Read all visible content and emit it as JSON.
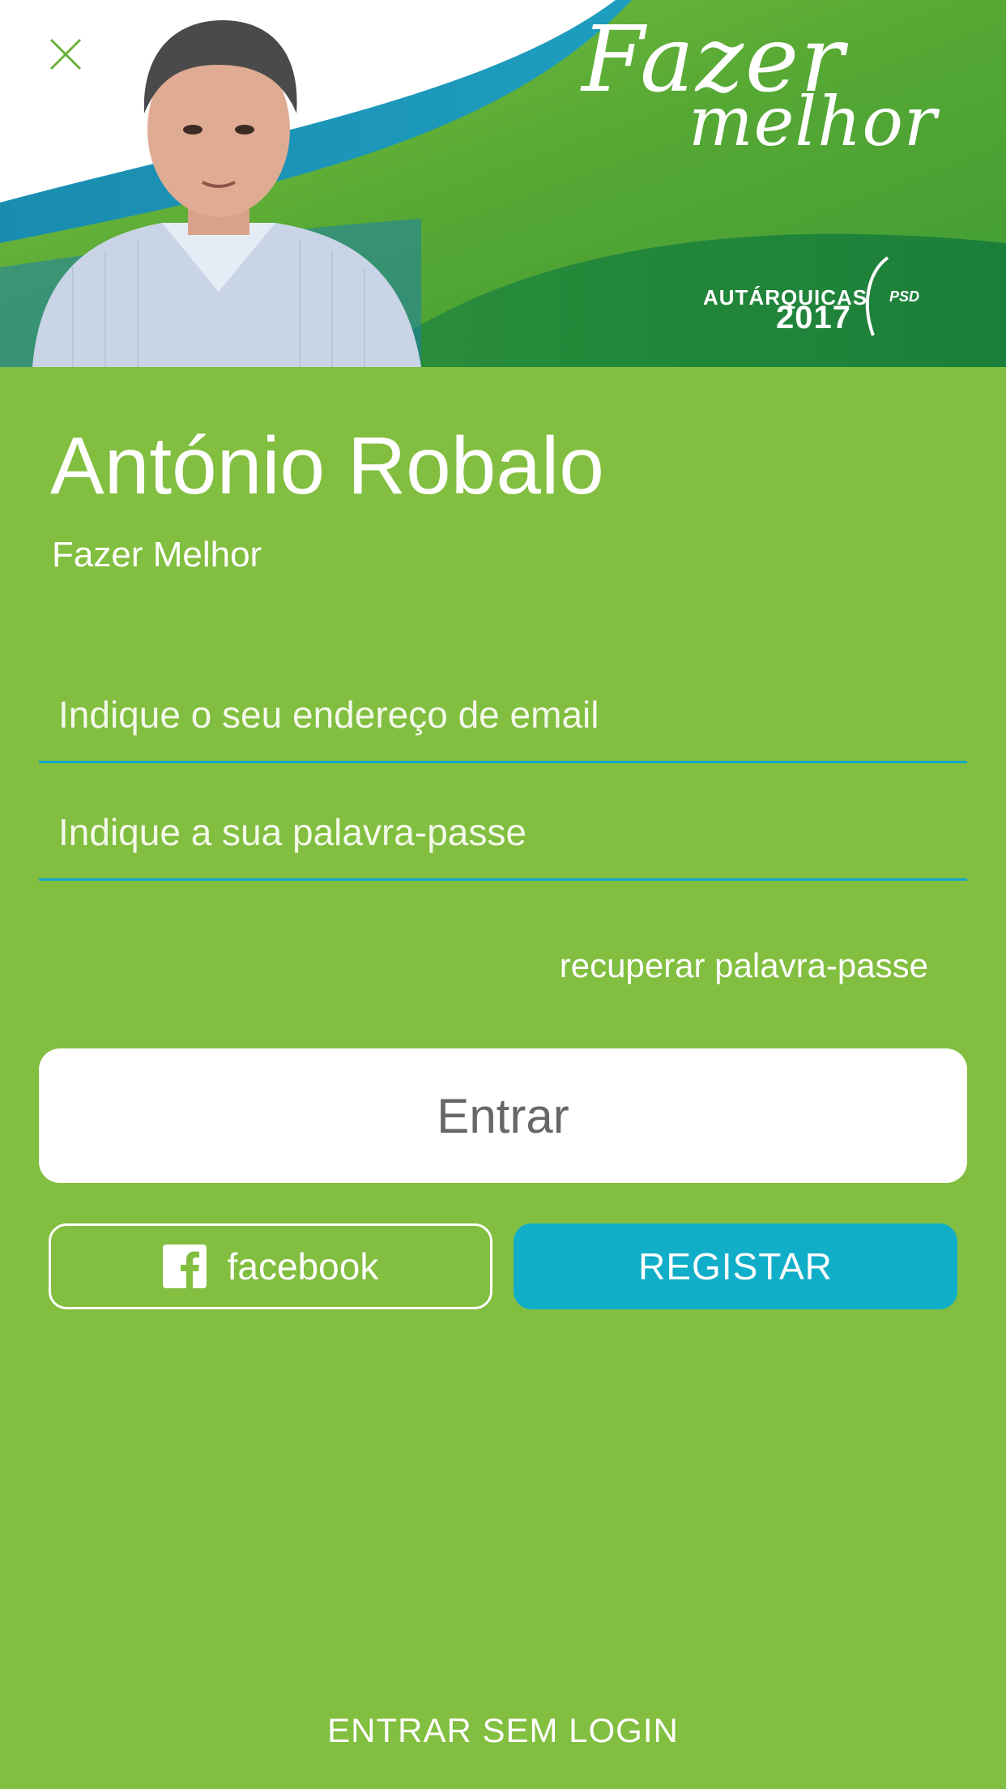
{
  "banner": {
    "slogan_line1": "Fazer",
    "slogan_line2": "melhor",
    "election_word": "AUTÁRQUICAS",
    "election_year": "2017",
    "party": "PSD"
  },
  "candidate": {
    "name": "António Robalo",
    "tagline": "Fazer Melhor"
  },
  "form": {
    "email_placeholder": "Indique o seu endereço de email",
    "email_value": "",
    "password_placeholder": "Indique a sua palavra-passe",
    "password_value": "",
    "recover_label": "recuperar palavra-passe",
    "enter_label": "Entrar",
    "facebook_label": "facebook",
    "register_label": "REGISTAR"
  },
  "footer": {
    "no_login_label": "ENTRAR SEM LOGIN"
  },
  "colors": {
    "background": "#82be3f",
    "accent_blue": "#10aec8",
    "banner_green": "#4a9e2f",
    "banner_dark_green": "#1b7f3a",
    "text_dark": "#66676a"
  },
  "icons": {
    "close": "close-icon",
    "facebook": "facebook-icon"
  }
}
